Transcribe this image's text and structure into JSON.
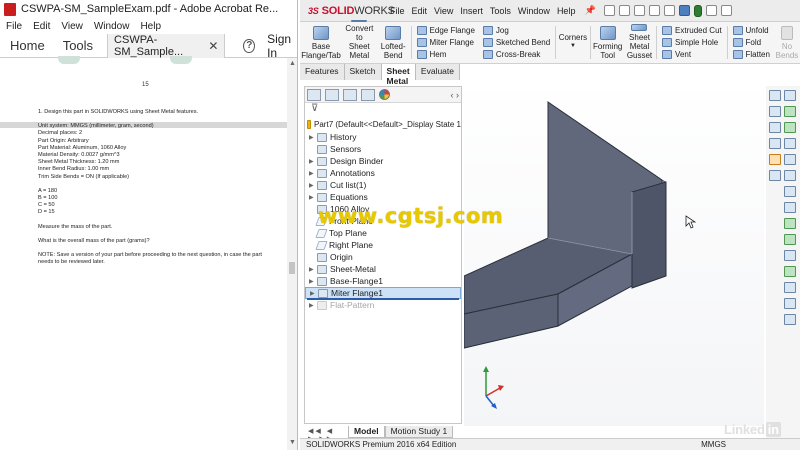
{
  "acrobat": {
    "title": "CSWPA-SM_SampleExam.pdf - Adobe Acrobat Re...",
    "menu": [
      "File",
      "Edit",
      "View",
      "Window",
      "Help"
    ],
    "toolbar": {
      "home": "Home",
      "tools": "Tools",
      "doc_tab": "CSWPA-SM_Sample...",
      "help": "?",
      "sign_in": "Sign In"
    },
    "page_number": "15",
    "content": {
      "question": "1. Design this part in SOLIDWORKS using Sheet Metal features.",
      "specs": [
        "Unit system: MMGS (millimeter, gram, second)",
        "Decimal places: 2",
        "Part Origin: Arbitrary",
        "Part Material: Aluminum, 1060 Alloy",
        "Material Density: 0.0027 g/mm^3",
        "Sheet Metal Thickness: 1.20 mm",
        "Inner Bend Radius: 1.00 mm",
        "Trim Side Bends = ON (If applicable)"
      ],
      "dims": [
        "A = 180",
        "B = 100",
        "C = 50",
        "D = 15"
      ],
      "measure": "Measure the mass of the part.",
      "ask": "What is the overall mass of the part (grams)?",
      "note": "NOTE: Save a version of your part before proceeding to the next question, in case the part needs to be reviewed later."
    }
  },
  "solidworks": {
    "logo_ds": "3S",
    "logo_solid": "SOLID",
    "logo_works": "WORKS",
    "menu": [
      "File",
      "Edit",
      "View",
      "Insert",
      "Tools",
      "Window",
      "Help"
    ],
    "commands": {
      "base_flange": "Base Flange/Tab",
      "convert": "Convert to Sheet Metal",
      "lofted_bend": "Lofted-Bend",
      "edge_flange": "Edge Flange",
      "miter_flange": "Miter Flange",
      "hem": "Hem",
      "jog": "Jog",
      "sketched_bend": "Sketched Bend",
      "cross_break": "Cross-Break",
      "corners": "Corners",
      "forming_tool": "Forming Tool",
      "sheet_metal_gusset": "Sheet Metal Gusset",
      "extruded_cut": "Extruded Cut",
      "simple_hole": "Simple Hole",
      "vent": "Vent",
      "unfold": "Unfold",
      "fold": "Fold",
      "flatten": "Flatten",
      "no_bends": "No Bends"
    },
    "tabs": [
      "Features",
      "Sketch",
      "Sheet Metal",
      "Evaluate"
    ],
    "active_tab": "Sheet Metal",
    "tree_root": "Part7 (Default<<Default>_Display State 1",
    "tree_items": [
      "History",
      "Sensors",
      "Design Binder",
      "Annotations",
      "Cut list(1)",
      "Equations",
      "1060 Alloy",
      "Front Plane",
      "Top Plane",
      "Right Plane",
      "Origin",
      "Sheet-Metal",
      "Base-Flange1",
      "Miter Flange1",
      "Flat-Pattern"
    ],
    "bottom_tabs": [
      "Model",
      "Motion Study 1"
    ],
    "status_left": "SOLIDWORKS Premium 2016 x64 Edition",
    "status_units": "MMGS",
    "colors": {
      "accent": "#c8102e",
      "part_face": "#5d6478",
      "part_edge": "#2b2f3a",
      "selection": "#cde1f7"
    }
  },
  "overlay": {
    "watermark": "www.cgtsj.com",
    "brand": "Linked",
    "brand_in": "in"
  }
}
